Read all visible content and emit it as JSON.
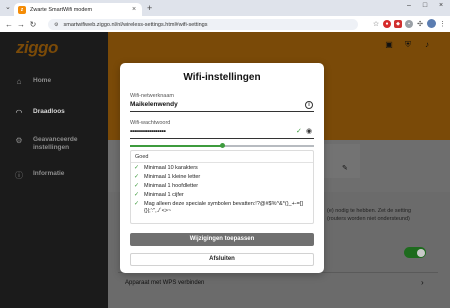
{
  "browser": {
    "tab_title": "Zwarte SmartWifi modem",
    "tab_favicon_letter": "z",
    "url": "smartwifiweb.ziggo.nl/nl/wireless-settings.html#wifi-settings"
  },
  "app": {
    "logo": "ziggo",
    "sidebar": [
      {
        "label": "Home",
        "icon": "home-icon"
      },
      {
        "label": "Draadloos",
        "icon": "wifi-icon"
      },
      {
        "label": "Geavanceerde instellingen",
        "icon": "gear-icon"
      },
      {
        "label": "Informatie",
        "icon": "info-icon"
      }
    ],
    "background_text": {
      "line1": "(e) nodig te hebben. Zet de setting",
      "line2": "(routers worden niet ondersteund)",
      "wps": "Apparaat met WPS verbinden"
    },
    "colors": {
      "brand_orange": "#f48c06",
      "dimmed_orange": "#7a4a08",
      "success_green": "#3e9b3e",
      "toggle_green": "#1e6b1e"
    }
  },
  "modal": {
    "title": "Wifi-instellingen",
    "network_name_label": "Wifi-netwerknaam",
    "network_name_value": "Maikelenwendy",
    "password_label": "Wifi-wachtwoord",
    "password_value": "••••••••••••••••••",
    "strength_fraction": 0.5,
    "strength_status": "Goed",
    "requirements": [
      "Minimaal 10 karakters",
      "Minimaal 1 kleine letter",
      "Minimaal 1 hoofdletter",
      "Minimaal 1 cijfer",
      "Mag alleen deze speciale symbolen bevatten:!?@#$%^&*()_+-=[]{}|;':\",./`<>~"
    ],
    "apply_button": "Wijzigingen toepassen",
    "close_button": "Afsluiten"
  }
}
